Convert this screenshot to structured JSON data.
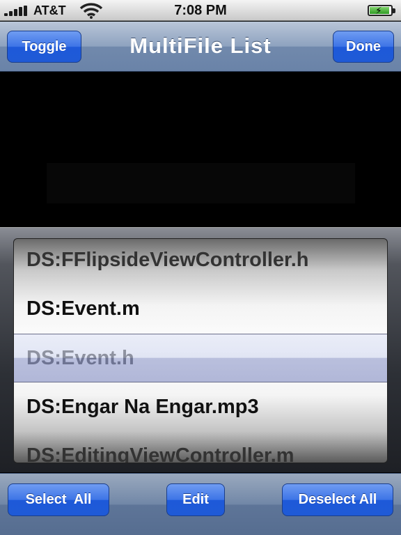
{
  "status_bar": {
    "carrier": "AT&T",
    "time": "7:08 PM",
    "signal_icon": "signal-bars-icon",
    "wifi_icon": "wifi-icon",
    "battery_icon": "battery-charging-icon"
  },
  "nav": {
    "title": "MultiFile List",
    "left_button": "Toggle",
    "right_button": "Done"
  },
  "picker": {
    "rows": [
      "DS:FFlipsideViewController.h",
      "DS:Event.m",
      "DS:Event.h",
      "DS:Engar Na Engar.mp3",
      "DS:EditingViewController.m"
    ],
    "selected": "DS:Event.h"
  },
  "toolbar": {
    "select_all": "Select  All",
    "edit": "Edit",
    "deselect_all": "Deselect All"
  },
  "colors": {
    "button_blue": "#1f5ad6",
    "nav_bar": "#7189ac",
    "toolbar": "#5e7598",
    "battery_green": "#2f9b25"
  }
}
